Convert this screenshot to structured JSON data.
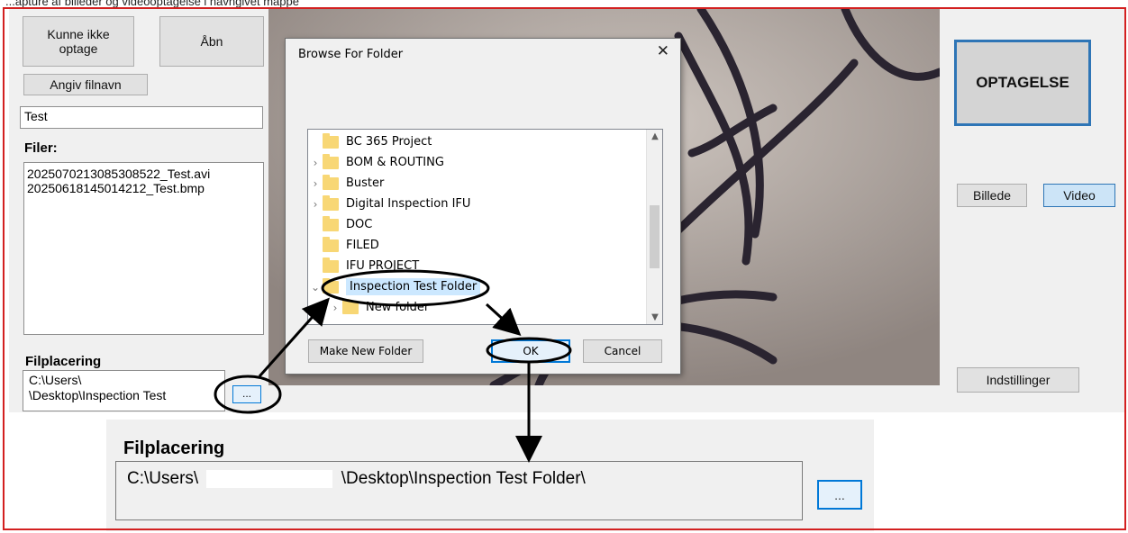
{
  "caption": "...apture af billeder og videooptagelse i navngivet mappe",
  "app": {
    "btn_fail": "Kunne ikke optage",
    "btn_open": "Åbn",
    "btn_filename": "Angiv filnavn",
    "filename_value": "Test",
    "files_label": "Filer:",
    "files": [
      "20250702130853085​22_Test.avi",
      "20250618145014212_Test.bmp"
    ],
    "location_label": "Filplacering",
    "path_line1": "C:\\Users\\",
    "path_line2": "\\Desktop\\Inspection Test",
    "browse_label": "...",
    "record_label": "OPTAGELSE",
    "mode_image": "Billede",
    "mode_video": "Video",
    "settings_label": "Indstillinger"
  },
  "dialog": {
    "title": "Browse For Folder",
    "close": "✕",
    "folders": [
      {
        "name": "BC 365 Project",
        "chevron": ""
      },
      {
        "name": "BOM & ROUTING",
        "chevron": "›"
      },
      {
        "name": "Buster",
        "chevron": "›"
      },
      {
        "name": "Digital Inspection IFU",
        "chevron": "›"
      },
      {
        "name": "DOC",
        "chevron": ""
      },
      {
        "name": "FILED",
        "chevron": ""
      },
      {
        "name": "IFU PROJECT",
        "chevron": ""
      },
      {
        "name": "Inspection Test Folder",
        "chevron": "⌄",
        "selected": true
      },
      {
        "name": "New folder",
        "chevron": "›"
      }
    ],
    "make_new_folder": "Make New Folder",
    "ok": "OK",
    "cancel": "Cancel"
  },
  "zoom": {
    "label": "Filplacering",
    "path_prefix": "C:\\Users\\",
    "path_suffix": "\\Desktop\\Inspection Test Folder\\",
    "browse_label": "..."
  },
  "colors": {
    "highlight_border": "#d32020",
    "selection": "#cce8ff",
    "accent": "#0078d7",
    "folder": "#f8d775"
  }
}
